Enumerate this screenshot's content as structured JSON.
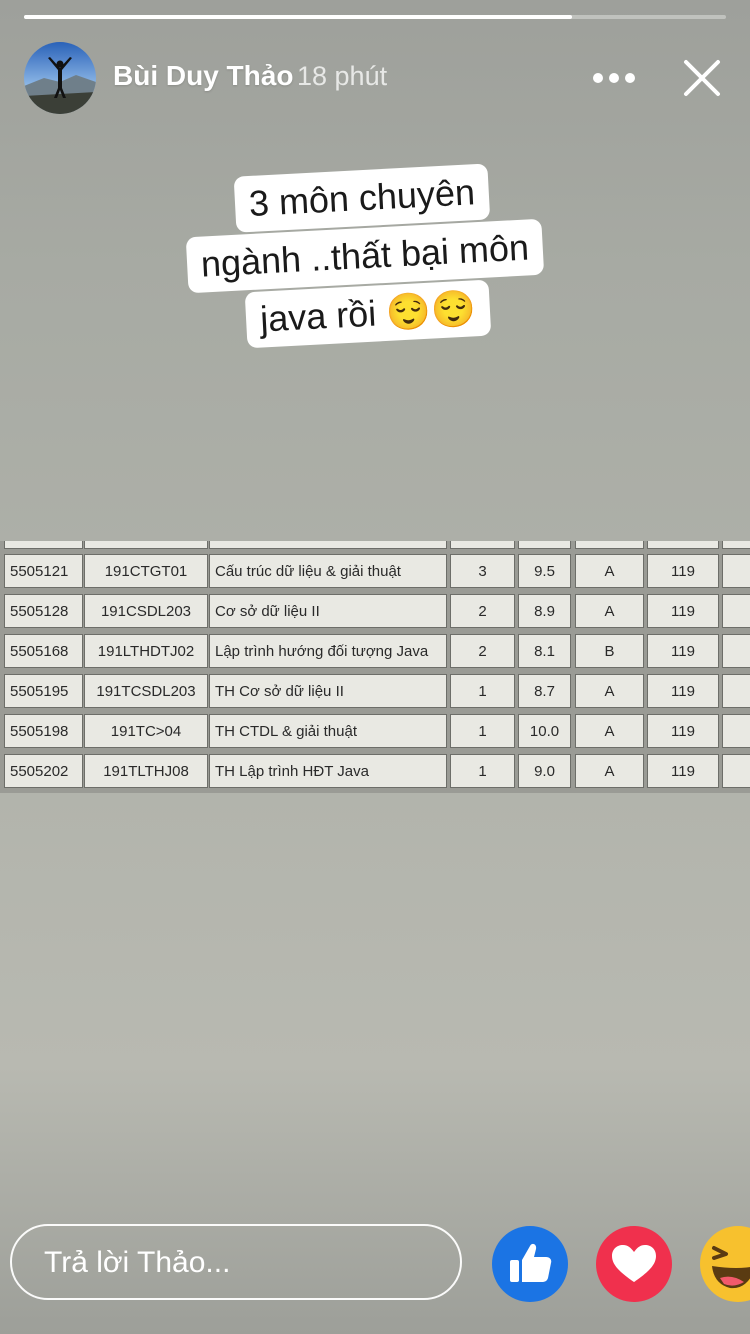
{
  "story": {
    "progress": 0.78,
    "author": "Bùi Duy Thảo",
    "time": "18 phút",
    "caption_lines": [
      "3 môn chuyên",
      "ngành ..thất bại môn",
      "java rồi 😌😌"
    ]
  },
  "table": {
    "rows": [
      [
        "5505121",
        "191CTGT01",
        "Cấu trúc dữ liệu & giải thuật",
        "3",
        "9.5",
        "A",
        "119"
      ],
      [
        "5505128",
        "191CSDL203",
        "Cơ sở dữ liệu II",
        "2",
        "8.9",
        "A",
        "119"
      ],
      [
        "5505168",
        "191LTHDTJ02",
        "Lập trình hướng đối tượng Java",
        "2",
        "8.1",
        "B",
        "119"
      ],
      [
        "5505195",
        "191TCSDL203",
        "TH Cơ sở dữ liệu II",
        "1",
        "8.7",
        "A",
        "119"
      ],
      [
        "5505198",
        "191TC>04",
        "TH CTDL & giải thuật",
        "1",
        "10.0",
        "A",
        "119"
      ],
      [
        "5505202",
        "191TLTHJ08",
        "TH Lập trình HĐT Java",
        "1",
        "9.0",
        "A",
        "119"
      ]
    ]
  },
  "reply": {
    "placeholder": "Trả lời Thảo..."
  },
  "icons": {
    "more": "more-horizontal-icon",
    "close": "close-icon",
    "like": "like-icon",
    "love": "love-icon",
    "haha": "haha-icon"
  },
  "colors": {
    "like": "#1b74e4",
    "love": "#f0304d",
    "haha": "#f7c12e"
  }
}
